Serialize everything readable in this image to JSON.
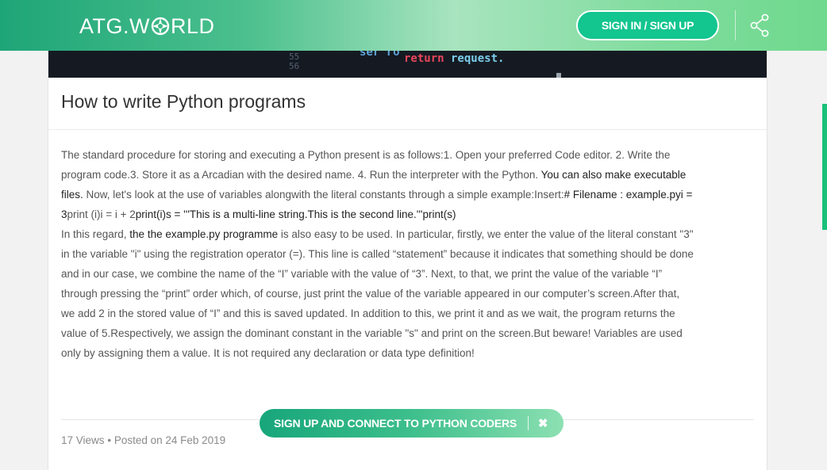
{
  "header": {
    "logo_prefix": "ATG.W",
    "logo_suffix": "RLD",
    "signin_label": "SIGN IN / SIGN UP"
  },
  "hero": {
    "code_line1": "ser  ro",
    "code_kw": "return",
    "code_fn": " request.",
    "line_numbers": "55\n56"
  },
  "article": {
    "title": "How to write Python programs",
    "p1_a": "The standard procedure for storing and executing a Python present is as follows:1. Open your preferred Code editor. 2. Write the program code.3. Store it as a Arcadian with the desired name. 4. Run the interpreter with the Python. ",
    "p1_b": "You can also make executable files.",
    "p1_c": " Now, let's look at the use of variables alongwith the literal constants through a simple example:Insert:",
    "p1_d": "# Filename : example.pyi = 3",
    "p1_e": "print (i)i = i + 2",
    "p1_f": "print(i)s = '''This is a multi-line string.This is the second line.'''print(s)",
    "p2_a": "In this regard, ",
    "p2_b": "the the example.py programme",
    "p2_c": " is also easy to be used. In particular, firstly, we enter the value of the literal constant \"3\" in the variable \"i\" using the registration operator (=). This line is called “statement” because it indicates that something should be done and in our case, we combine the name of the “I” variable with the value of “3”. Next, to that, we print the value of the variable “I” through pressing the “print” order which, of course, just print the value of the variable appeared in our computer’s screen.After that, we add 2 in the stored value of “I” and this is saved updated. In addition to this, we print it and as we wait, the program returns the value of 5.Respectively,  we assign the dominant constant in the variable \"s\" and print on the screen.But beware! Variables are used only by assigning them a value. It is not required any declaration or data type definition!",
    "views": "17 Views",
    "bullet": "•",
    "posted": "Posted on 24 Feb 2019"
  },
  "cta": {
    "label": "SIGN UP AND CONNECT TO PYTHON CODERS",
    "close": "✖"
  },
  "colors": {
    "brand_green": "#13c58f",
    "accent_green": "#19c07a",
    "title_text": "#333333",
    "body_text": "#555555"
  }
}
